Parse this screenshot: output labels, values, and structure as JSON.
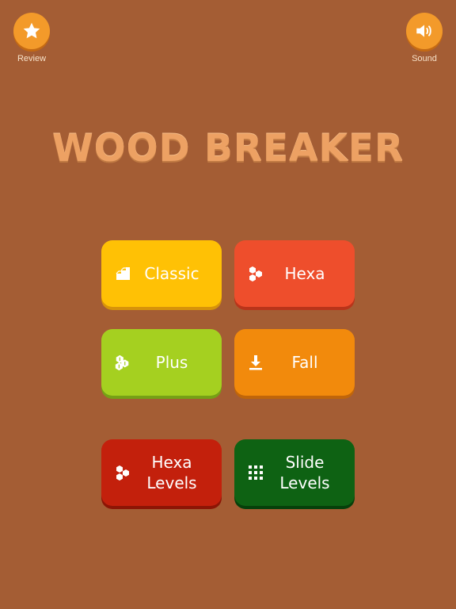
{
  "header": {
    "review_label": "Review",
    "sound_label": "Sound",
    "review_icon": "star-icon",
    "sound_icon": "speaker-icon"
  },
  "title": "WOOD BREAKER",
  "modes": {
    "classic": {
      "label": "Classic",
      "icon": "block-stack-icon",
      "color": "#ffc105"
    },
    "hexa": {
      "label": "Hexa",
      "icon": "hexagons-icon",
      "color": "#ee4e2c"
    },
    "plus": {
      "label": "Plus",
      "icon": "plus-blocks-icon",
      "color": "#a5d020"
    },
    "fall": {
      "label": "Fall",
      "icon": "download-arrow-icon",
      "color": "#f28a0c"
    },
    "hexa_levels": {
      "label_line1": "Hexa",
      "label_line2": "Levels",
      "icon": "hexagons-icon",
      "color": "#c3200c"
    },
    "slide_levels": {
      "label_line1": "Slide",
      "label_line2": "Levels",
      "icon": "grid-dots-icon",
      "color": "#0e6213"
    }
  },
  "colors": {
    "background": "#a45d34",
    "top_button": "#f39a2a",
    "title": "#eda163"
  }
}
